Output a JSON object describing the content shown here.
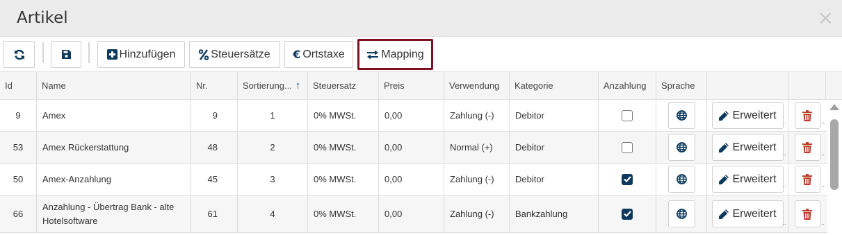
{
  "dialog": {
    "title": "Artikel",
    "close": "×"
  },
  "toolbar": {
    "refresh": "refresh-icon",
    "save": "save-icon",
    "add_label": "Hinzufügen",
    "taxes_label": "Steuersätze",
    "localtax_label": "Ortstaxe",
    "mapping_label": "Mapping"
  },
  "table": {
    "columns": [
      "Id",
      "Name",
      "Nr.",
      "Sortierung...",
      "Steuersatz",
      "Preis",
      "Verwendung",
      "Kategorie",
      "Anzahlung",
      "Sprache"
    ],
    "sort_indicator": "↑",
    "extended_label": "Erweitert",
    "rows": [
      {
        "id": "9",
        "name": "Amex",
        "nr": "9",
        "sort": "1",
        "tax": "0% MWSt.",
        "price": "0,00",
        "usage": "Zahlung (-)",
        "category": "Debitor",
        "deposit": false
      },
      {
        "id": "53",
        "name": "Amex Rückerstattung",
        "nr": "48",
        "sort": "2",
        "tax": "0% MWSt.",
        "price": "0,00",
        "usage": "Normal (+)",
        "category": "Debitor",
        "deposit": false
      },
      {
        "id": "50",
        "name": "Amex-Anzahlung",
        "nr": "45",
        "sort": "3",
        "tax": "0% MWSt.",
        "price": "0,00",
        "usage": "Zahlung (-)",
        "category": "Debitor",
        "deposit": true
      },
      {
        "id": "66",
        "name": "Anzahlung - Übertrag Bank - alte Hotelsoftware",
        "nr": "61",
        "sort": "4",
        "tax": "0% MWSt.",
        "price": "0,00",
        "usage": "Zahlung (-)",
        "category": "Bankzahlung",
        "deposit": true
      }
    ]
  },
  "colors": {
    "accent": "#0b3a5c",
    "highlight": "#7a1222",
    "delete": "#c0392b"
  }
}
